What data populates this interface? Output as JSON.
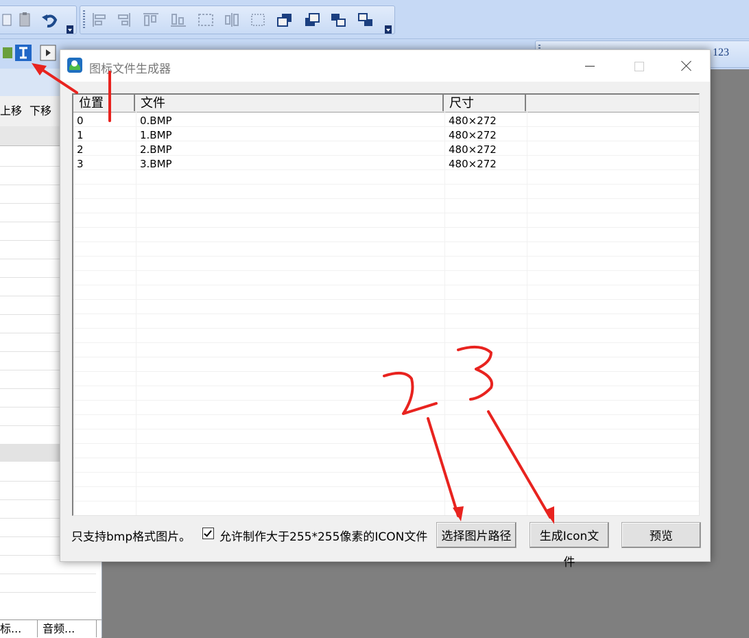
{
  "toolbar": {
    "buttons": [
      "paste-icon",
      "undo-icon",
      "align-left-icon",
      "align-right-icon",
      "align-top-icon",
      "align-bottom-icon",
      "center-h-icon",
      "center-v-icon",
      "distribute-icon",
      "bring-front-icon",
      "send-back-icon",
      "bring-forward-icon",
      "send-backward-icon"
    ],
    "row2_right_label": "123"
  },
  "left_panel": {
    "move_up": "上移",
    "move_down": "下移",
    "tab_1": "标...",
    "tab_2": "音频..."
  },
  "dialog": {
    "title": "图标文件生成器",
    "columns": [
      "位置",
      "文件",
      "尺寸"
    ],
    "rows": [
      {
        "pos": "0",
        "file": "0.BMP",
        "size": "480×272"
      },
      {
        "pos": "1",
        "file": "1.BMP",
        "size": "480×272"
      },
      {
        "pos": "2",
        "file": "2.BMP",
        "size": "480×272"
      },
      {
        "pos": "3",
        "file": "3.BMP",
        "size": "480×272"
      }
    ],
    "support_note": "只支持bmp格式图片。",
    "allow_large_checked": true,
    "allow_large_label": "允许制作大于255*255像素的ICON文件",
    "btn_select_path": "选择图片路径",
    "btn_generate": "生成Icon文件",
    "btn_preview": "预览"
  },
  "annotations": {
    "label_2": "2",
    "label_3": "3",
    "color": "#e8231f"
  }
}
